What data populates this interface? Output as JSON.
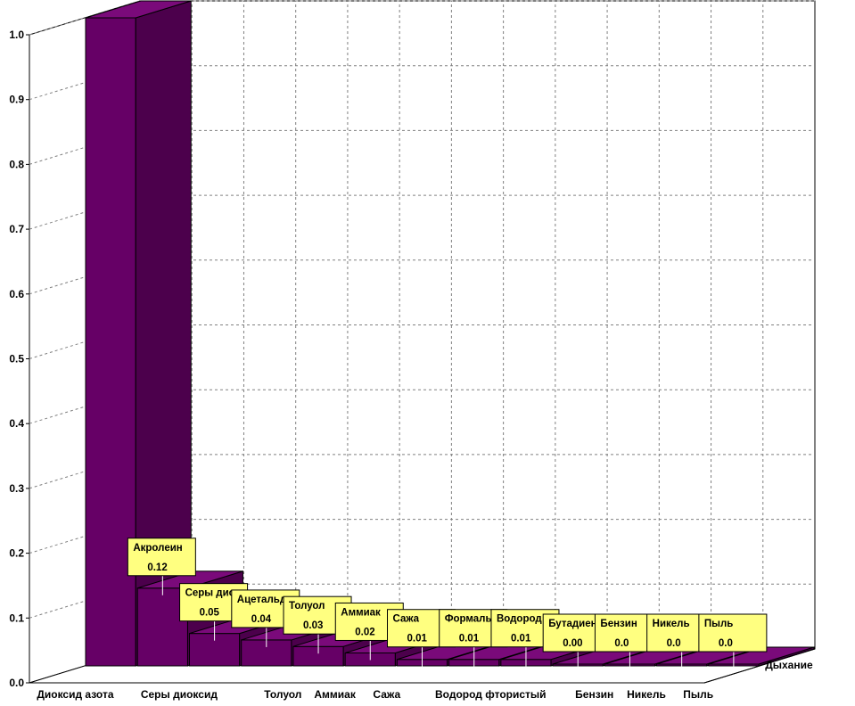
{
  "chart_data": {
    "type": "bar",
    "style": "3d",
    "series": [
      {
        "name": "Дыхание",
        "values": [
          1.0,
          0.12,
          0.05,
          0.04,
          0.03,
          0.02,
          0.01,
          0.01,
          0.01,
          0.0,
          0.0,
          0.0,
          0.0
        ]
      }
    ],
    "categories": [
      "Диоксид азота",
      "Акролеин",
      "Серы диоксид",
      "Ацетальдегид",
      "Толуол",
      "Аммиак",
      "Сажа",
      "Формальдегид",
      "Водород фтористый",
      "Бутадиен",
      "Бензин",
      "Никель",
      "Пыль"
    ],
    "category_labels": [
      "Диоксид азота",
      "",
      "Серы диоксид",
      "",
      "Толуол",
      "Аммиак",
      "Сажа",
      "",
      "Водород фтористый",
      "",
      "Бензин",
      "Никель",
      "Пыль"
    ],
    "annotations": [
      {
        "index": 1,
        "name": "Акролеин",
        "value": "0.12"
      },
      {
        "index": 2,
        "name": "Серы диоксид",
        "value": "0.05"
      },
      {
        "index": 3,
        "name": "Ацетальдегид",
        "value": "0.04"
      },
      {
        "index": 4,
        "name": "Толуол",
        "value": "0.03"
      },
      {
        "index": 5,
        "name": "Аммиак",
        "value": "0.02"
      },
      {
        "index": 6,
        "name": "Сажа",
        "value": "0.01"
      },
      {
        "index": 7,
        "name": "Формальдегид",
        "value": "0.01"
      },
      {
        "index": 8,
        "name": "Водород фтористый",
        "value": "0.01"
      },
      {
        "index": 9,
        "name": "Бутадиен",
        "value": "0.00"
      },
      {
        "index": 10,
        "name": "Бензин",
        "value": "0.0"
      },
      {
        "index": 11,
        "name": "Никель",
        "value": "0.0"
      },
      {
        "index": 12,
        "name": "Пыль",
        "value": "0.0"
      }
    ],
    "y_ticks": [
      "0.0",
      "0.1",
      "0.2",
      "0.3",
      "0.4",
      "0.5",
      "0.6",
      "0.7",
      "0.8",
      "0.9",
      "1.0"
    ],
    "ylim": [
      0,
      1.0
    ],
    "depth_label": "Дыхание",
    "grid": true,
    "colors": {
      "bar_front": "#660066",
      "bar_side": "#4c004c",
      "bar_top": "#7a0a7a",
      "label_box": "#ffff80",
      "grid": "#808080"
    }
  }
}
